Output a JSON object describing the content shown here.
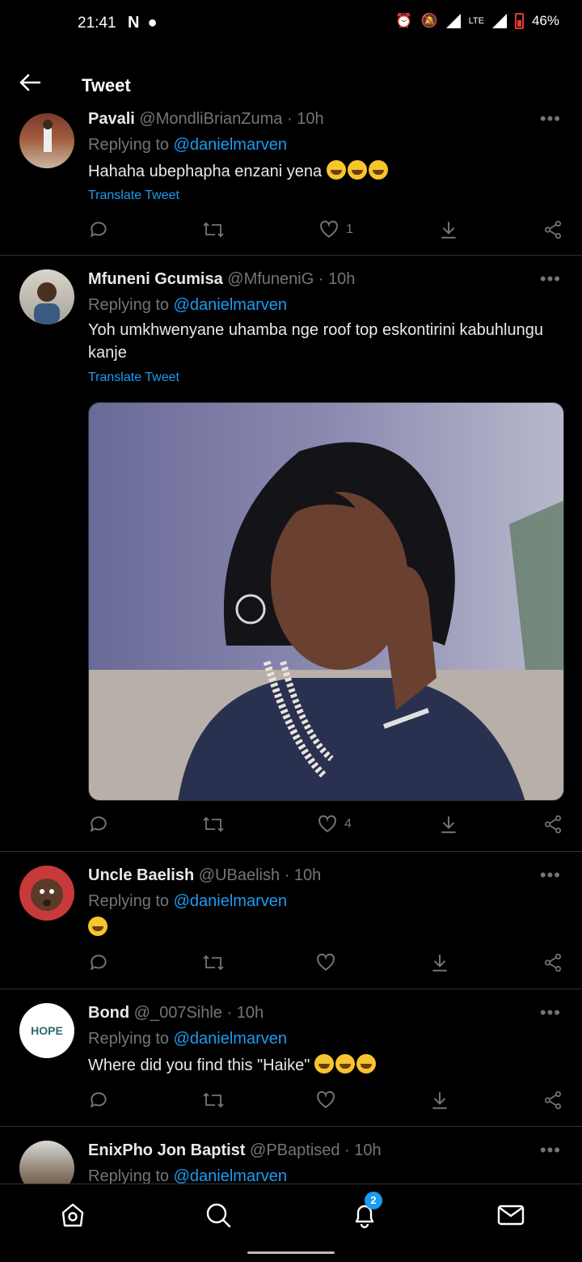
{
  "status_bar": {
    "time": "21:41",
    "network": "LTE",
    "battery": "46%"
  },
  "header": {
    "title": "Tweet",
    "back_icon": "arrow-left-icon"
  },
  "tweets": [
    {
      "name": "Pavali",
      "handle": "@MondliBrianZuma",
      "time": "10h",
      "replying_label": "Replying to",
      "replying_to": "@danielmarven",
      "text": "Hahaha ubephapha enzani yena",
      "emojis": [
        "face-with-tears-of-joy",
        "face-with-tears-of-joy",
        "face-with-tears-of-joy"
      ],
      "translate": "Translate Tweet",
      "likes": "1"
    },
    {
      "name": "Mfuneni Gcumisa",
      "handle": "@MfuneniG",
      "time": "10h",
      "replying_label": "Replying to",
      "replying_to": "@danielmarven",
      "text": "Yoh umkhwenyane uhamba nge roof top eskontirini kabuhlungu kanje",
      "translate": "Translate Tweet",
      "likes": "4"
    },
    {
      "name": "Uncle Baelish",
      "handle": "@UBaelish",
      "time": "10h",
      "replying_label": "Replying to",
      "replying_to": "@danielmarven",
      "emojis": [
        "exploding-head"
      ]
    },
    {
      "name": "Bond",
      "handle": "@_007Sihle",
      "time": "10h",
      "replying_label": "Replying to",
      "replying_to": "@danielmarven",
      "text": "Where did you find this \"Haike\"",
      "emojis": [
        "grinning-sweat",
        "rolling-on-floor-laughing",
        "face-with-tears-of-joy"
      ],
      "avatar_text": "HOPE"
    },
    {
      "name": "EnixPho Jon Baptist",
      "handle": "@PBaptised",
      "time": "10h",
      "replying_label": "Replying to",
      "replying_to": "@danielmarven"
    }
  ],
  "bottom_nav": {
    "items": [
      "home-icon",
      "search-icon",
      "notifications-icon",
      "messages-icon"
    ],
    "notification_badge": "2"
  },
  "colors": {
    "background": "#000000",
    "accent": "#1d9bf0",
    "muted": "#71767b",
    "divider": "#2f3336"
  }
}
